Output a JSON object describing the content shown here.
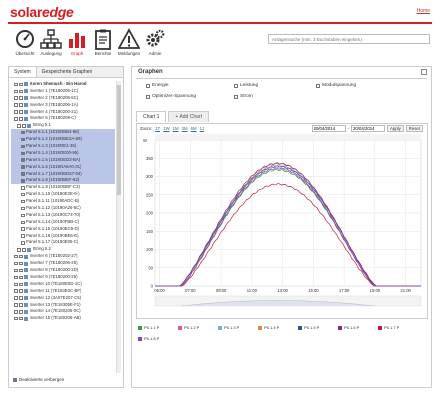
{
  "header": {
    "logo_solar": "solar",
    "logo_edge": "edge",
    "home_link": "Home",
    "nav": [
      {
        "label": "Übersicht",
        "icon": "dashboard-gauge-icon"
      },
      {
        "label": "Auslegung",
        "icon": "site-layout-icon"
      },
      {
        "label": "Graph",
        "icon": "bar-chart-icon"
      },
      {
        "label": "Berichte",
        "icon": "report-clipboard-icon"
      },
      {
        "label": "Meldungen",
        "icon": "warning-triangle-icon"
      },
      {
        "label": "Admin",
        "icon": "gears-icon"
      }
    ],
    "search_placeholder": "Anlagensuche (min. 3 Buchstaben eingeben)"
  },
  "left_panel": {
    "tabs": [
      "System",
      "Gespeicherte Graphen"
    ],
    "tree": [
      {
        "label": "Koren Shemush - Ein Harod",
        "bold": true
      },
      {
        "label": "Inverter 1 (7E180206-1C)"
      },
      {
        "label": "Inverter 2 (7E180205-5C)"
      },
      {
        "label": "Inverter 3 (7E180206-1A)"
      },
      {
        "label": "Inverter 4 (7E180200-21)"
      },
      {
        "label": "Inverter 5 (7E180208-C)"
      },
      {
        "label": "String 5.1"
      },
      {
        "label": "Panel 5.1.1 (1019OBB4-88)"
      },
      {
        "label": "Panel 5.1.2 (1019OBE2A-66)"
      },
      {
        "label": "Panel 5.1.3 (1019OE2-35)"
      },
      {
        "label": "Panel 5.1.4 (1019OE00-95)"
      },
      {
        "label": "Panel 5.1.5 (1019OED3-BA)"
      },
      {
        "label": "Panel 5.1.6 (1019OA5A0-31)"
      },
      {
        "label": "Panel 5.1.7 (1019OBD57-04)"
      },
      {
        "label": "Panel 5.1.8 (1019OBEF-62)"
      },
      {
        "label": "Panel 5.1.9 (1019OBBF-C3)"
      },
      {
        "label": "Panel 5.1.10 (10190E2E-9-)"
      },
      {
        "label": "Panel 5.1.11 (10190ADC-B)"
      },
      {
        "label": "Panel 5.1.12 (10190A26-5C)"
      },
      {
        "label": "Panel 5.1.13 (10190C74-70)"
      },
      {
        "label": "Panel 5.1.14 (10190FBB-C)"
      },
      {
        "label": "Panel 5.1.15 (10190EC9-D)"
      },
      {
        "label": "Panel 5.1.16 (10190BE6-E)"
      },
      {
        "label": "Panel 5.1.17 (10190E05-C)"
      },
      {
        "label": "String 5.2"
      },
      {
        "label": "Inverter 6 (7E180202-27)"
      },
      {
        "label": "Inverter 7 (7E180206-25)"
      },
      {
        "label": "Inverter 8 (7E180200-2D)"
      },
      {
        "label": "Inverter 9 (7E180200-25)"
      },
      {
        "label": "Inverter 10 (7E180E5D-1C)"
      },
      {
        "label": "Inverter 11 (7E183E0C-BF)"
      },
      {
        "label": "Inverter 12 (3A07E207-C5)"
      },
      {
        "label": "Inverter 13 (7E18305E-F1)"
      },
      {
        "label": "Inverter 14 (7E180206-0C)"
      },
      {
        "label": "Inverter 15 (7E180206-AB)"
      }
    ],
    "hide_deactivated": "Deaktivierte verbergen"
  },
  "graphs": {
    "title": "Graphen",
    "options": [
      "Energie",
      "Leistung",
      "Modulspannung",
      "Optimizer-Spannung",
      "Strom"
    ],
    "tabs": [
      "Chart 1",
      "+ Add Chart"
    ],
    "zoom_label": "Zoom:",
    "zoom_options": [
      "1T",
      "1W",
      "1M",
      "3M",
      "6M",
      "1J"
    ],
    "date_from": "20/04/2014",
    "date_to": "20/04/2014",
    "apply": "Apply",
    "reset": "Reset"
  },
  "chart_data": {
    "type": "line",
    "ylabel": "W",
    "ylim": [
      0,
      400
    ],
    "yticks": [
      0,
      50,
      100,
      150,
      200,
      250,
      300,
      350
    ],
    "xlim": [
      4.7,
      22
    ],
    "xticks": [
      "05:00",
      "07:00",
      "09:00",
      "11:00",
      "13:00",
      "15:00",
      "17:00",
      "19:00",
      "21:00"
    ],
    "xtick_hours": [
      5,
      7,
      9,
      11,
      13,
      15,
      17,
      19,
      21
    ],
    "grid": true,
    "series": [
      {
        "name": "P5.1.1 P",
        "color": "#3a9e3a",
        "peak": 318,
        "start": 6.4,
        "end": 19.0
      },
      {
        "name": "P5.1.2 P",
        "color": "#e05a9a",
        "peak": 325,
        "start": 6.35,
        "end": 19.0
      },
      {
        "name": "P5.1.3 P",
        "color": "#6fb0d8",
        "peak": 330,
        "start": 6.35,
        "end": 19.05
      },
      {
        "name": "P5.1.4 P",
        "color": "#e08a3a",
        "peak": 335,
        "start": 6.4,
        "end": 19.05
      },
      {
        "name": "P5.1.5 P",
        "color": "#3b4fa8",
        "peak": 328,
        "start": 6.3,
        "end": 19.1
      },
      {
        "name": "P5.1.6 P",
        "color": "#8a2a8a",
        "peak": 336,
        "start": 6.3,
        "end": 19.05
      },
      {
        "name": "P5.1.7 P",
        "color": "#c02040",
        "peak": 279,
        "start": 6.45,
        "end": 18.95
      },
      {
        "name": "P5.1.8 P",
        "color": "#7b4fb8",
        "peak": 322,
        "start": 6.4,
        "end": 19.0
      }
    ]
  }
}
